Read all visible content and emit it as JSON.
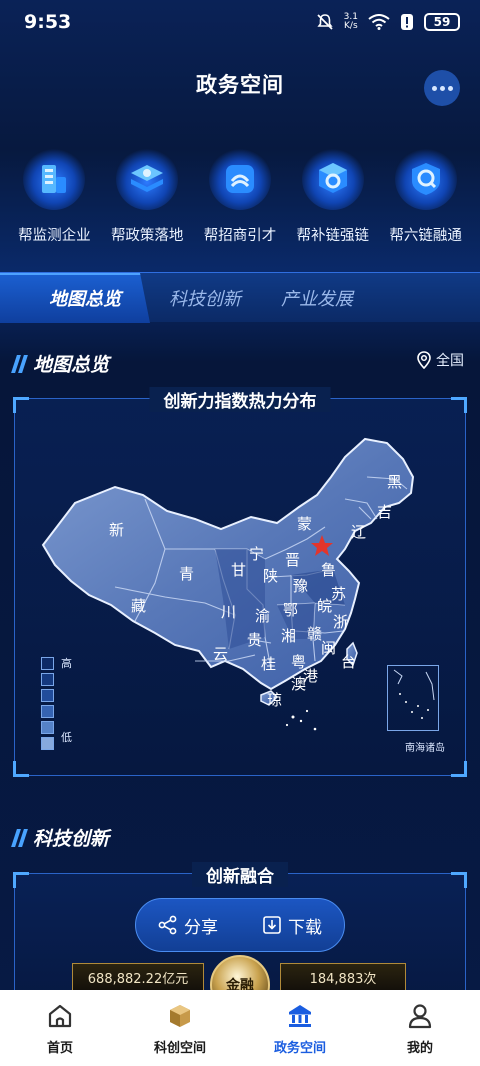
{
  "status_bar": {
    "time": "9:53",
    "net_speed_value": "3.1",
    "net_speed_unit": "K/s",
    "battery": "59"
  },
  "header": {
    "title": "政务空间"
  },
  "services": [
    {
      "label": "帮监测企业",
      "icon": "building-chart-icon"
    },
    {
      "label": "帮政策落地",
      "icon": "layers-icon"
    },
    {
      "label": "帮招商引才",
      "icon": "handshake-icon"
    },
    {
      "label": "帮补链强链",
      "icon": "link-cube-icon"
    },
    {
      "label": "帮六链融通",
      "icon": "chain-shield-icon"
    }
  ],
  "tabs": [
    "地图总览",
    "科技创新",
    "产业发展"
  ],
  "map_section": {
    "title": "地图总览",
    "region": "全国",
    "panel_title": "创新力指数热力分布",
    "legend_high": "高",
    "legend_low": "低",
    "inset_label": "南海诸岛",
    "provinces": [
      "新",
      "藏",
      "青",
      "甘",
      "宁",
      "蒙",
      "黑",
      "吉",
      "辽",
      "晋",
      "陕",
      "川",
      "渝",
      "贵",
      "云",
      "桂",
      "粤",
      "湘",
      "鄂",
      "豫",
      "鲁",
      "皖",
      "苏",
      "浙",
      "赣",
      "闽",
      "琼",
      "台",
      "港",
      "澳"
    ]
  },
  "tech_section": {
    "title": "科技创新",
    "panel_title": "创新融合",
    "share_label": "分享",
    "download_label": "下载",
    "stat_left": "688,882.22亿元",
    "stat_center": "金融",
    "stat_right": "184,883次"
  },
  "bottom_nav": [
    {
      "label": "首页",
      "icon": "home-icon"
    },
    {
      "label": "科创空间",
      "icon": "cube-icon"
    },
    {
      "label": "政务空间",
      "icon": "government-icon"
    },
    {
      "label": "我的",
      "icon": "person-icon"
    }
  ],
  "colors": {
    "accent": "#1a5de0",
    "background": "#06163a",
    "legend_scale": [
      "#0d2a66",
      "#15397f",
      "#214c9b",
      "#3563b2",
      "#5582c8",
      "#86a9de"
    ]
  }
}
